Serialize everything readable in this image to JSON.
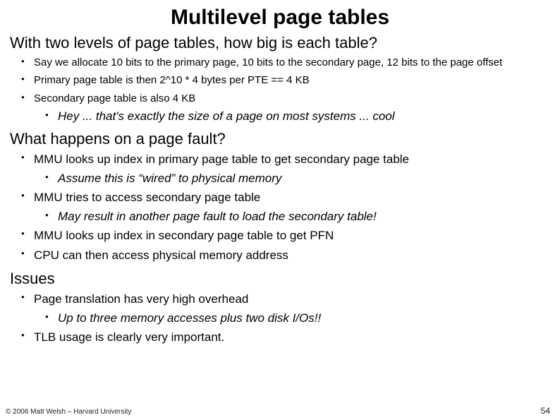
{
  "title": "Multilevel page tables",
  "section1": {
    "heading": "With two levels of page tables, how big is each table?",
    "items": [
      {
        "text": "Say we allocate 10 bits to the primary page, 10 bits to the secondary page, 12 bits to the page offset"
      },
      {
        "text": "Primary page table is then 2^10 * 4 bytes per PTE == 4 KB"
      },
      {
        "text": "Secondary page table is also 4 KB",
        "sub": [
          "Hey ... that's exactly the size of a page on most systems ... cool"
        ]
      }
    ]
  },
  "section2": {
    "heading": "What happens on a page fault?",
    "items": [
      {
        "text": "MMU looks up index in primary page table to get secondary page table",
        "sub": [
          "Assume this is “wired” to physical memory"
        ]
      },
      {
        "text": "MMU tries to access secondary page table",
        "sub": [
          "May result in another page fault to load the secondary table!"
        ]
      },
      {
        "text": "MMU looks up index in secondary page table to get PFN"
      },
      {
        "text": "CPU can then access physical memory address"
      }
    ]
  },
  "section3": {
    "heading": "Issues",
    "items": [
      {
        "text": "Page translation has very high overhead",
        "sub": [
          "Up to three memory accesses plus two disk I/Os!!"
        ]
      },
      {
        "text": "TLB usage is clearly very important."
      }
    ]
  },
  "footer": {
    "left": "© 2006 Matt Welsh – Harvard University",
    "right": "54"
  }
}
